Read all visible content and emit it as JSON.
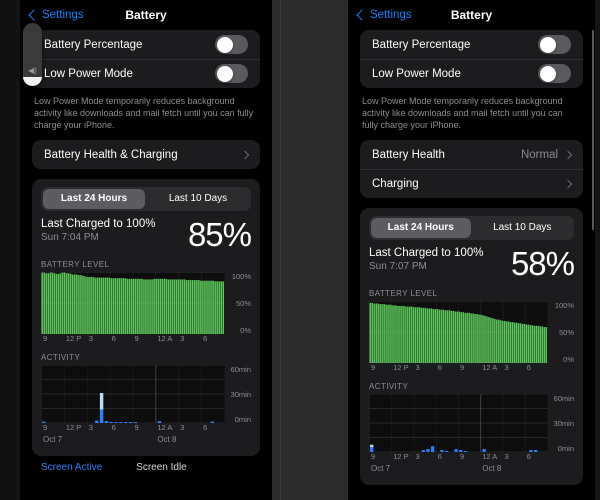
{
  "theme": {
    "accent_blue": "#0a84ff",
    "green": "#5cc85c",
    "activity_blue": "#2d7ff9",
    "activity_idle": "#bcdcff",
    "card_bg": "#1c1c1e",
    "page_bg": "#000000",
    "muted_text": "#8d8d93"
  },
  "panels": [
    {
      "id": "left",
      "nav": {
        "back_label": "Settings",
        "title": "Battery",
        "back_icon": "chevron-left-icon"
      },
      "settings_card": {
        "rows": [
          {
            "label": "Battery Percentage",
            "control": "toggle",
            "state": "on"
          },
          {
            "label": "Low Power Mode",
            "control": "toggle",
            "state": "on"
          }
        ]
      },
      "footnote": "Low Power Mode temporarily reduces background activity like downloads and mail fetch until you can fully charge your iPhone.",
      "links_card": {
        "rows": [
          {
            "label": "Battery Health & Charging",
            "value": "",
            "chevron_icon": "chevron-right-icon"
          }
        ]
      },
      "usage": {
        "segments": [
          {
            "label": "Last 24 Hours",
            "selected": true
          },
          {
            "label": "Last 10 Days",
            "selected": false
          }
        ],
        "charge_title": "Last Charged to 100%",
        "charge_sub": "Sun 7:04 PM",
        "big_percent": "85%",
        "battery_level_label": "BATTERY LEVEL",
        "activity_label": "ACTIVITY",
        "legend": [
          {
            "label": "Screen Active",
            "color": "#2d7ff9"
          },
          {
            "label": "Screen Idle",
            "color": "#d9d9de"
          }
        ]
      },
      "overlay": {
        "name": "volume-hud",
        "icon": "speaker-icon",
        "level_percent": 14
      },
      "chart_data": [
        {
          "type": "area",
          "title": "BATTERY LEVEL",
          "xlabel": "",
          "ylabel": "",
          "ylim": [
            0,
            100
          ],
          "ytick_labels": [
            "100%",
            "50%",
            "0%"
          ],
          "ytick_values": [
            100,
            50,
            0
          ],
          "xtick_labels": [
            "9",
            "12 P",
            "3",
            "6",
            "9",
            "12 A",
            "3",
            "6"
          ],
          "grid": true,
          "values": [
            99,
            99,
            98,
            98,
            99,
            99,
            98,
            97,
            97,
            98,
            99,
            99,
            98,
            98,
            97,
            96,
            96,
            96,
            95,
            95,
            94,
            93,
            92,
            92,
            92,
            92,
            91,
            91,
            91,
            91,
            91,
            91,
            91,
            91,
            90,
            90,
            90,
            90,
            90,
            90,
            90,
            90,
            89,
            89,
            89,
            89,
            89,
            89,
            89,
            89,
            88,
            88,
            88,
            88,
            88,
            89,
            89,
            89,
            89,
            89,
            89,
            89,
            88,
            88,
            88,
            88,
            88,
            88,
            88,
            88,
            88,
            87,
            87,
            87,
            87,
            87,
            87,
            87,
            86,
            86,
            86,
            86,
            86,
            86,
            86,
            85,
            85,
            85,
            85,
            85
          ],
          "series_color": "#5cc85c"
        },
        {
          "type": "bar",
          "title": "ACTIVITY",
          "ylim": [
            0,
            60
          ],
          "ytick_labels": [
            "60min",
            "30min",
            "0min"
          ],
          "ytick_values": [
            60,
            30,
            0
          ],
          "xtick_labels": [
            "9",
            "12 P",
            "3",
            "6",
            "9",
            "12 A",
            "3",
            "6"
          ],
          "date_labels": [
            "Oct 7",
            "Oct 8"
          ],
          "grid": true,
          "series": [
            {
              "name": "Screen Active",
              "color": "#2d7ff9",
              "values": [
                1.5,
                0,
                0,
                0,
                0,
                0,
                0,
                0,
                0,
                0,
                0,
                2.5,
                14,
                2,
                1,
                1,
                1,
                1,
                1,
                1,
                0,
                0,
                0,
                0,
                2,
                0,
                0,
                0,
                0,
                0,
                0,
                0,
                0,
                0,
                0,
                1.5,
                0,
                0
              ]
            },
            {
              "name": "Screen Idle",
              "color": "#bcdcff",
              "values": [
                0,
                0,
                0,
                0,
                0,
                0,
                0,
                0,
                0,
                0,
                0,
                0,
                17,
                0,
                0,
                0,
                0,
                0,
                0,
                0,
                0,
                0,
                0,
                0,
                0,
                0,
                0,
                0,
                0,
                0,
                0,
                0,
                0,
                0,
                0,
                0,
                0,
                0
              ]
            }
          ]
        }
      ]
    },
    {
      "id": "right",
      "nav": {
        "back_label": "Settings",
        "title": "Battery",
        "back_icon": "chevron-left-icon"
      },
      "settings_card": {
        "rows": [
          {
            "label": "Battery Percentage",
            "control": "toggle",
            "state": "on"
          },
          {
            "label": "Low Power Mode",
            "control": "toggle",
            "state": "on"
          }
        ]
      },
      "footnote": "Low Power Mode temporarily reduces background activity like downloads and mail fetch until you can fully charge your iPhone.",
      "links_card": {
        "rows": [
          {
            "label": "Battery Health",
            "value": "Normal",
            "chevron_icon": "chevron-right-icon"
          },
          {
            "label": "Charging",
            "value": "",
            "chevron_icon": "chevron-right-icon"
          }
        ]
      },
      "usage": {
        "segments": [
          {
            "label": "Last 24 Hours",
            "selected": true
          },
          {
            "label": "Last 10 Days",
            "selected": false
          }
        ],
        "charge_title": "Last Charged to 100%",
        "charge_sub": "Sun 7:07 PM",
        "big_percent": "58%",
        "battery_level_label": "BATTERY LEVEL",
        "activity_label": "ACTIVITY",
        "legend": []
      },
      "chart_data": [
        {
          "type": "area",
          "title": "BATTERY LEVEL",
          "ylim": [
            0,
            100
          ],
          "ytick_labels": [
            "100%",
            "50%",
            "0%"
          ],
          "ytick_values": [
            100,
            50,
            0
          ],
          "xtick_labels": [
            "9",
            "12 P",
            "3",
            "6",
            "9",
            "12 A",
            "3",
            "6"
          ],
          "grid": true,
          "values": [
            97,
            97,
            96,
            96,
            96,
            95,
            95,
            95,
            94,
            94,
            94,
            93,
            93,
            93,
            92,
            92,
            92,
            92,
            91,
            91,
            91,
            91,
            90,
            90,
            90,
            90,
            89,
            89,
            89,
            88,
            88,
            88,
            87,
            87,
            87,
            86,
            86,
            86,
            85,
            85,
            85,
            84,
            84,
            83,
            83,
            83,
            82,
            82,
            81,
            81,
            81,
            80,
            80,
            79,
            79,
            78,
            78,
            77,
            76,
            75,
            74,
            73,
            72,
            71,
            70,
            70,
            69,
            68,
            68,
            67,
            67,
            66,
            66,
            65,
            65,
            64,
            64,
            63,
            63,
            62,
            62,
            61,
            61,
            60,
            60,
            60,
            59,
            59,
            58,
            58
          ],
          "series_color": "#5cc85c"
        },
        {
          "type": "bar",
          "title": "ACTIVITY",
          "ylim": [
            0,
            60
          ],
          "ytick_labels": [
            "60min",
            "30min",
            "0min"
          ],
          "ytick_values": [
            60,
            30,
            0
          ],
          "xtick_labels": [
            "9",
            "12 P",
            "3",
            "6",
            "9",
            "12 A",
            "3",
            "6"
          ],
          "date_labels": [
            "Oct 7",
            "Oct 8"
          ],
          "grid": true,
          "series": [
            {
              "name": "Screen Active",
              "color": "#2d7ff9",
              "values": [
                5,
                0,
                0,
                0,
                0,
                0,
                0,
                0,
                0,
                0,
                0,
                2,
                3,
                6,
                0,
                2,
                1,
                0,
                3,
                2,
                1,
                0,
                0,
                0,
                3,
                0,
                0,
                0,
                0,
                0,
                0,
                0,
                0,
                0,
                2,
                2,
                0,
                0
              ]
            },
            {
              "name": "Screen Idle",
              "color": "#bcdcff",
              "values": [
                2.5,
                0,
                0,
                0,
                0,
                0,
                0,
                0,
                0,
                0,
                0,
                0,
                0,
                0,
                0,
                0,
                0,
                0,
                0,
                0,
                0,
                0,
                0,
                0,
                0,
                0,
                0,
                0,
                0,
                0,
                0,
                0,
                0,
                0,
                0,
                0,
                0,
                0
              ]
            }
          ]
        }
      ],
      "scrollbar": {
        "visible": true
      }
    }
  ]
}
